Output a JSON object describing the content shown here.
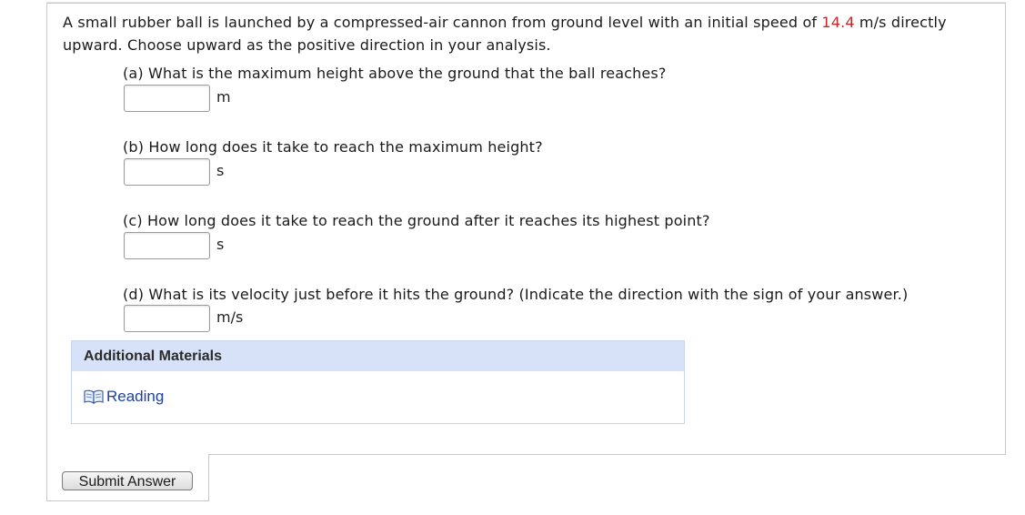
{
  "problem": {
    "intro_pre": "A small rubber ball is launched by a compressed-air cannon from ground level with an initial speed of ",
    "speed_value": "14.4",
    "intro_post": " m/s directly upward. Choose upward as the positive direction in your analysis."
  },
  "questions": [
    {
      "label": "(a) What is the maximum height above the ground that the ball reaches?",
      "value": "",
      "unit": "m"
    },
    {
      "label": "(b) How long does it take to reach the maximum height?",
      "value": "",
      "unit": "s"
    },
    {
      "label": "(c) How long does it take to reach the ground after it reaches its highest point?",
      "value": "",
      "unit": "s"
    },
    {
      "label": "(d) What is its velocity just before it hits the ground? (Indicate the direction with the sign of your answer.)",
      "value": "",
      "unit": "m/s"
    }
  ],
  "additional_materials": {
    "title": "Additional Materials",
    "items": [
      {
        "label": "Reading",
        "icon": "book-icon"
      }
    ]
  },
  "submit": {
    "label": "Submit Answer"
  },
  "colors": {
    "highlight_value": "#c5282b",
    "panel_header": "#d7e1f7",
    "link": "#1f3fa8"
  }
}
